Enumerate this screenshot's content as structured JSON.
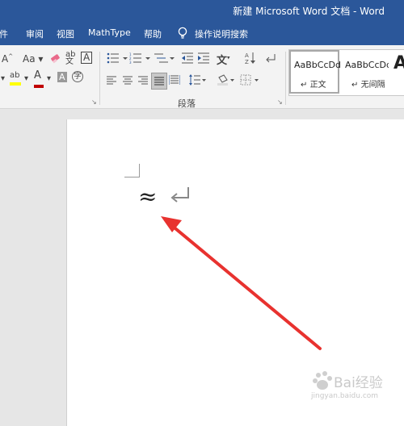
{
  "title": "新建 Microsoft Word 文档 - Word",
  "menu": {
    "items": [
      "邮件",
      "审阅",
      "视图",
      "MathType",
      "帮助"
    ],
    "search_label": "操作说明搜索"
  },
  "ribbon": {
    "font_row1": {
      "grow_font": "A",
      "case": "Aa",
      "phonetic": "文"
    },
    "font_row2": {
      "font_color": "A",
      "char_shade": "A",
      "enclose": "字"
    },
    "paragraph_label": "段落",
    "launcher": "↘",
    "styles": [
      {
        "sample": "AaBbCcDd",
        "name": "正文",
        "mark": "↵"
      },
      {
        "sample": "AaBbCcDd",
        "name": "无间隔",
        "mark": "↵"
      },
      {
        "sample": "A",
        "name": "",
        "mark": ""
      }
    ]
  },
  "document": {
    "symbol": "≈"
  },
  "colors": {
    "title_bar": "#2b579a",
    "arrow": "#e8322f",
    "highlight": "#ffff00",
    "font_color": "#c00000"
  },
  "watermark": {
    "brand": "Bai经验",
    "url": "jingyan.baidu.com"
  }
}
